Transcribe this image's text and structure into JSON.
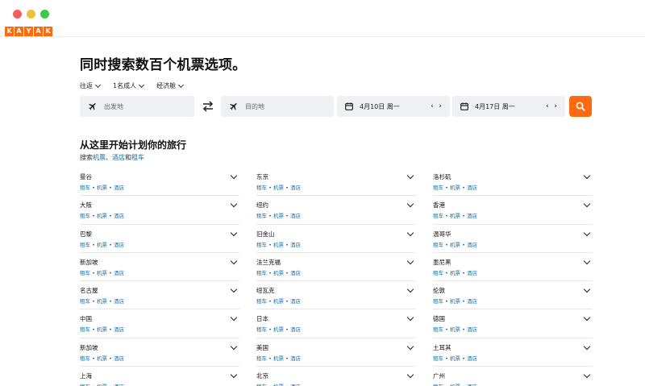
{
  "window": {
    "controls": [
      "close",
      "minimize",
      "maximize"
    ]
  },
  "brand": {
    "letters": [
      "K",
      "A",
      "Y",
      "A",
      "K"
    ],
    "color": "#ff690f"
  },
  "headline": "同时搜索数百个机票选项。",
  "options": [
    {
      "label": "往返"
    },
    {
      "label": "1名成人"
    },
    {
      "label": "经济舱"
    }
  ],
  "search": {
    "origin_placeholder": "出发地",
    "destination_placeholder": "目的地",
    "depart_date": "4月10日 周一",
    "return_date": "4月17日 周一",
    "date_arrows": "‹ ›",
    "icons": {
      "origin": "plane-icon",
      "destination": "plane-icon",
      "swap": "swap-arrows-icon",
      "date": "calendar-icon",
      "submit": "search-icon"
    }
  },
  "explore": {
    "title": "从这里开始计划你的旅行",
    "subtitle_prefix": "搜索",
    "subtitle_flights": "机票",
    "subtitle_sep": "、",
    "subtitle_hotels": "酒店",
    "subtitle_and": "和",
    "subtitle_cars": "租车"
  },
  "link_labels": {
    "car": "租车",
    "flight": "机票",
    "hotel": "酒店",
    "dot": "•"
  },
  "columns": [
    [
      "曼谷",
      "大阪",
      "巴黎",
      "新加坡",
      "名古屋",
      "中国",
      "新加坡",
      "上海"
    ],
    [
      "东京",
      "纽约",
      "旧金山",
      "法兰克福",
      "纽瓦克",
      "日本",
      "美国",
      "北京"
    ],
    [
      "洛杉矶",
      "香港",
      "温哥华",
      "墨尼黑",
      "伦敦",
      "德国",
      "土耳其",
      "广州"
    ]
  ],
  "colors": {
    "accent": "#ff690f",
    "link": "#1a6fa8",
    "field_bg": "#eef0f3"
  }
}
